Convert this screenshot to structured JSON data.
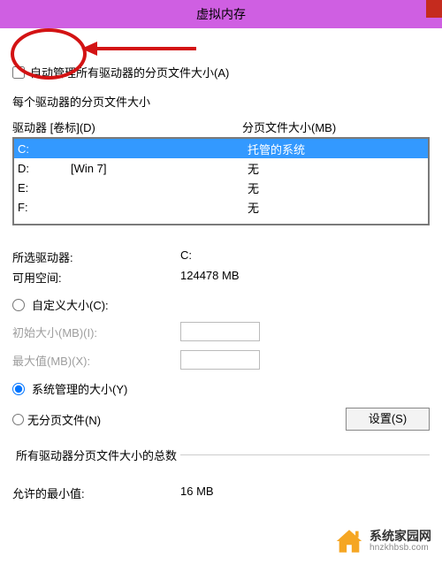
{
  "window": {
    "title": "虚拟内存"
  },
  "auto_manage": {
    "label": "自动管理所有驱动器的分页文件大小(A)",
    "checked": false
  },
  "per_drive_label": "每个驱动器的分页文件大小",
  "table": {
    "col_drive": "驱动器 [卷标](D)",
    "col_pf": "分页文件大小(MB)"
  },
  "drives": [
    {
      "letter": "C:",
      "label": "",
      "pf": "托管的系统",
      "selected": true
    },
    {
      "letter": "D:",
      "label": "[Win 7]",
      "pf": "无",
      "selected": false
    },
    {
      "letter": "E:",
      "label": "",
      "pf": "无",
      "selected": false
    },
    {
      "letter": "F:",
      "label": "",
      "pf": "无",
      "selected": false
    }
  ],
  "selected_drive": {
    "label": "所选驱动器:",
    "value": "C:"
  },
  "available": {
    "label": "可用空间:",
    "value": "124478 MB"
  },
  "custom_radio": "自定义大小(C):",
  "initial": {
    "label": "初始大小(MB)(I):",
    "value": ""
  },
  "max": {
    "label": "最大值(MB)(X):",
    "value": ""
  },
  "system_radio": "系统管理的大小(Y)",
  "none_radio": "无分页文件(N)",
  "set_button": "设置(S)",
  "totals": {
    "group": "所有驱动器分页文件大小的总数",
    "min_label": "允许的最小值:",
    "min_value": "16 MB"
  },
  "watermark": {
    "line1": "系统家园网",
    "line2": "hnzkhbsb.com"
  },
  "annotation": {
    "circle_color": "#d31314",
    "arrow_color": "#d31314"
  }
}
